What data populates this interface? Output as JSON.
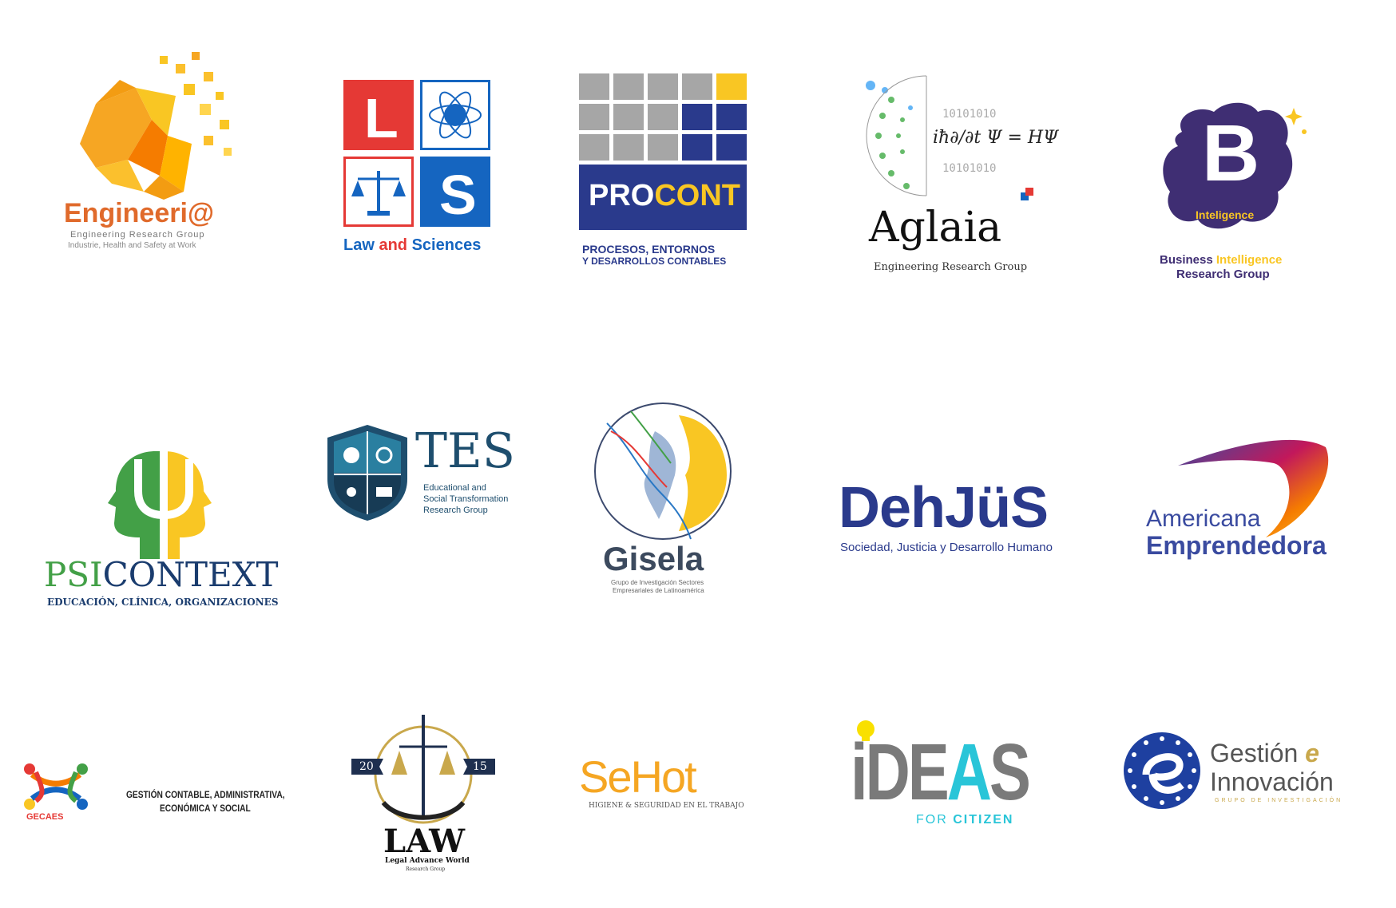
{
  "colors": {
    "orange": "#f39c12",
    "yellow": "#f9c623",
    "red": "#e53935",
    "blue": "#1565c0",
    "navy": "#2a3a8c",
    "gray": "#9e9e9e",
    "purple": "#3f2e73",
    "green": "#5cb85c",
    "teal": "#1e5f7a",
    "cyan": "#29c5d8"
  },
  "logos": {
    "engineeria": {
      "name": "Engineeri@",
      "line1": "Engineering Research Group",
      "line2": "Industrie, Health and Safety at Work"
    },
    "ls": {
      "letter_l": "L",
      "letter_s": "S",
      "label_law": "Law",
      "label_and": "and",
      "label_sciences": "Sciences"
    },
    "procont": {
      "pro": "PRO",
      "cont": "CONT",
      "line1": "PROCESOS, ENTORNOS",
      "line2": "Y DESARROLLOS CONTABLES"
    },
    "aglaia": {
      "formula": "iħ∂/∂t Ψ = HΨ",
      "binary": "10101010",
      "name": "Aglaia",
      "subtitle": "Engineering Research Group"
    },
    "bintel": {
      "letter": "B",
      "inner": "Inteligence",
      "line1a": "Business",
      "line1b": "Intelligence",
      "line2": "Research Group"
    },
    "psicontext": {
      "psi": "PSI",
      "context": "CONTEXT",
      "subtitle": "EDUCACIÓN, CLÍNICA, ORGANIZACIONES"
    },
    "tes": {
      "name": "TES",
      "line1": "Educational and",
      "line2": "Social Transformation",
      "line3": "Research Group"
    },
    "gisela": {
      "name": "Gisela",
      "line1": "Grupo de Investigación Sectores",
      "line2": "Empresariales de Latinoamérica"
    },
    "dehjus": {
      "name": "DehJüS",
      "subtitle": "Sociedad, Justicia y Desarrollo Humano"
    },
    "americana": {
      "line1": "Americana",
      "line2": "Emprendedora"
    },
    "gecaes": {
      "name": "GECAES",
      "line1": "GESTIÓN CONTABLE, ADMINISTRATIVA,",
      "line2": "ECONÓMICA Y SOCIAL"
    },
    "law": {
      "year_left": "20",
      "year_right": "15",
      "name": "LAW",
      "line1": "Legal Advance World",
      "line2": "Research Group"
    },
    "sehot": {
      "name": "SeHot",
      "subtitle": "HIGIENE & SEGURIDAD EN EL TRABAJO"
    },
    "ideas": {
      "ide": "iDE",
      "a": "A",
      "s": "S",
      "for": "FOR",
      "citizen": "CITIZEN"
    },
    "gestion": {
      "line1": "Gestión",
      "e": "e",
      "line2": "Innovación",
      "subtitle": "GRUPO DE INVESTIGACIÓN"
    }
  }
}
